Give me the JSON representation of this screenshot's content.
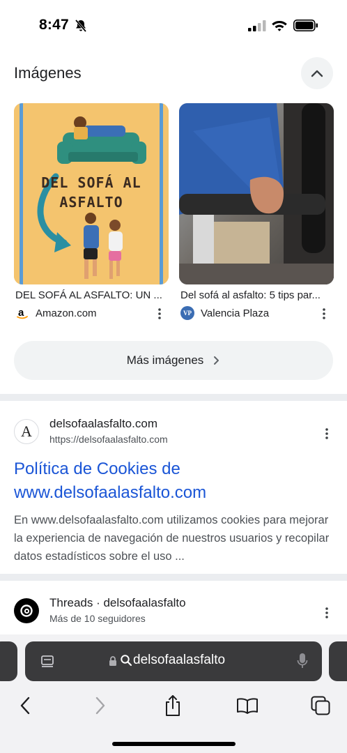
{
  "status_bar": {
    "time": "8:47",
    "icons": [
      "bell-slash-icon",
      "signal-icon",
      "wifi-icon",
      "battery-icon"
    ]
  },
  "images_section": {
    "title": "Imágenes",
    "collapse_icon": "chevron-up-icon",
    "cards": [
      {
        "image_text": "DEL SOFÁ AL ASFALTO",
        "caption": "DEL SOFÁ AL ASFALTO: UN ...",
        "source": "Amazon.com",
        "source_logo": "amazon-logo-icon"
      },
      {
        "image_text": "",
        "caption": "Del sofá al asfalto: 5 tips par...",
        "source": "Valencia Plaza",
        "source_logo_text": "VP"
      }
    ],
    "more_button": "Más imágenes"
  },
  "result": {
    "site_name": "delsofaalasfalto.com",
    "url": "https://delsofaalasfalto.com",
    "title_line1": "Política de Cookies de",
    "title_line2": "www.delsofaalasfalto.com",
    "snippet": "En www.delsofaalasfalto.com utilizamos cookies para mejorar la experiencia de navegación de nuestros usuarios y recopilar datos estadísticos sobre el uso ...",
    "favicon_letter": "A"
  },
  "threads_result": {
    "site_name": "Threads · delsofaalasfalto",
    "subtitle": "Más de 10 seguidores"
  },
  "browser": {
    "address": "delsofaalasfalto",
    "nav_icons": [
      "back-icon",
      "forward-icon",
      "share-icon",
      "bookmarks-icon",
      "tabs-icon"
    ]
  },
  "colors": {
    "link": "#1a55d6",
    "address_bar": "#3a3a3c",
    "chip_bg": "#f1f3f4"
  }
}
